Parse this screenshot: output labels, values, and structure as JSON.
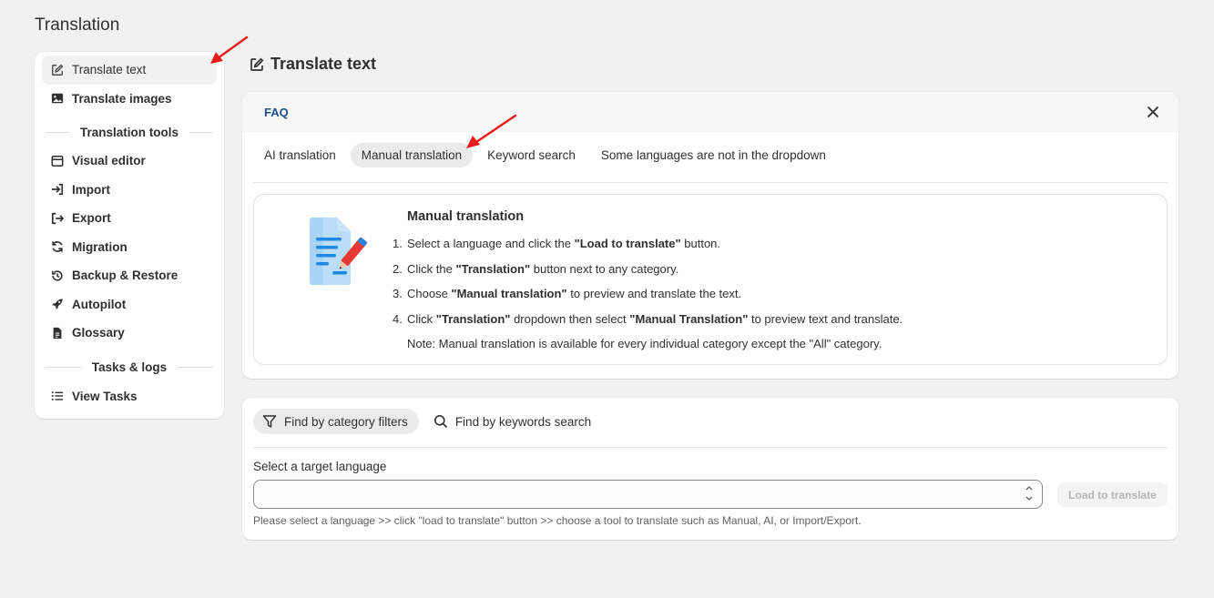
{
  "page": {
    "title": "Translation"
  },
  "sidebar": {
    "items": [
      {
        "label": "Translate text",
        "icon": "edit-icon",
        "active": true
      },
      {
        "label": "Translate images",
        "icon": "image-icon"
      }
    ],
    "tools_heading": "Translation tools",
    "tools": [
      {
        "label": "Visual editor",
        "icon": "visual-editor-icon"
      },
      {
        "label": "Import",
        "icon": "import-icon"
      },
      {
        "label": "Export",
        "icon": "export-icon"
      },
      {
        "label": "Migration",
        "icon": "refresh-icon"
      },
      {
        "label": "Backup & Restore",
        "icon": "history-icon"
      },
      {
        "label": "Autopilot",
        "icon": "rocket-icon"
      },
      {
        "label": "Glossary",
        "icon": "document-icon"
      }
    ],
    "tasks_heading": "Tasks & logs",
    "tasks": [
      {
        "label": "View Tasks",
        "icon": "list-icon"
      }
    ]
  },
  "main": {
    "title": "Translate text",
    "faq": {
      "title": "FAQ",
      "tabs": [
        {
          "label": "AI translation"
        },
        {
          "label": "Manual translation",
          "active": true
        },
        {
          "label": "Keyword search"
        },
        {
          "label": "Some languages are not in the dropdown"
        }
      ],
      "heading": "Manual translation",
      "steps": [
        {
          "num": "1.",
          "pre": "Select a language and click the ",
          "bold": "\"Load to translate\"",
          "post": " button."
        },
        {
          "num": "2.",
          "pre": "Click the ",
          "bold": "\"Translation\"",
          "post": " button next to any category."
        },
        {
          "num": "3.",
          "pre": "Choose ",
          "bold": "\"Manual translation\"",
          "post": " to preview and translate the text."
        },
        {
          "num": "4.",
          "pre": "Click ",
          "bold": "\"Translation\"",
          "mid": " dropdown then select ",
          "bold2": "\"Manual Translation\"",
          "post": " to preview text and translate."
        }
      ],
      "note": "Note: Manual translation is available for every individual category except the \"All\" category."
    },
    "filters": {
      "tabs": [
        {
          "label": "Find by category filters",
          "icon": "filter-icon",
          "active": true
        },
        {
          "label": "Find by keywords search",
          "icon": "search-icon"
        }
      ],
      "language_label": "Select a target language",
      "language_value": "",
      "load_button": "Load to translate",
      "help": "Please select a language >> click \"load to translate\" button >> choose a tool to translate such as Manual, AI, or Import/Export."
    }
  },
  "colors": {
    "background": "#f1f1f1",
    "card": "#ffffff",
    "annotation_arrow": "#e81c1c",
    "faq_title": "#1f4e8c"
  }
}
